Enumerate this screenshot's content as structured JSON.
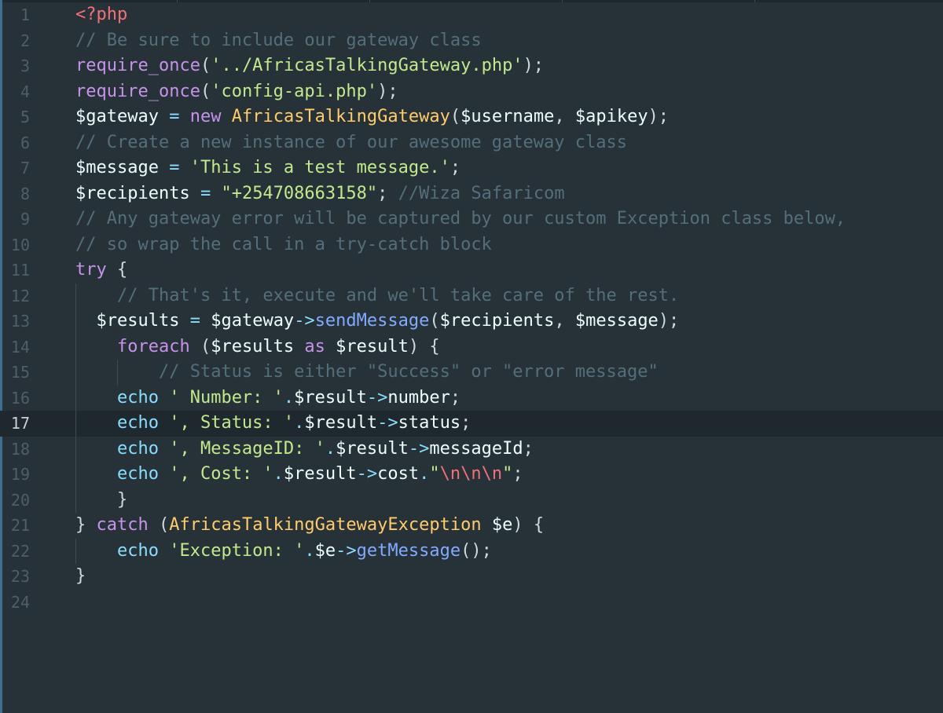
{
  "editor": {
    "language": "php",
    "active_line": 17,
    "colors": {
      "background": "#263238",
      "active_line_bg": "#1e282e",
      "line_number": "#4f5f68",
      "comment": "#546e7a",
      "string": "#c3e88d",
      "keyword": "#c792ea",
      "class_name": "#ffcb6b",
      "operator": "#89ddff",
      "method": "#82aaff",
      "php_tag": "#f07178"
    },
    "lines": [
      {
        "n": "1",
        "tokens": [
          {
            "t": "<?php",
            "c": "tag"
          }
        ]
      },
      {
        "n": "2",
        "tokens": [
          {
            "t": "// Be sure to include our gateway class",
            "c": "cmt"
          }
        ]
      },
      {
        "n": "3",
        "tokens": [
          {
            "t": "require_once",
            "c": "fn"
          },
          {
            "t": "(",
            "c": "punc"
          },
          {
            "t": "'../AfricasTalkingGateway.php'",
            "c": "str"
          },
          {
            "t": ");",
            "c": "punc"
          }
        ]
      },
      {
        "n": "4",
        "tokens": [
          {
            "t": "require_once",
            "c": "fn"
          },
          {
            "t": "(",
            "c": "punc"
          },
          {
            "t": "'config-api.php'",
            "c": "str"
          },
          {
            "t": ");",
            "c": "punc"
          }
        ]
      },
      {
        "n": "5",
        "tokens": [
          {
            "t": "$gateway",
            "c": "var"
          },
          {
            "t": " = ",
            "c": "op"
          },
          {
            "t": "new",
            "c": "kw"
          },
          {
            "t": " ",
            "c": "punc"
          },
          {
            "t": "AfricasTalkingGateway",
            "c": "cls"
          },
          {
            "t": "(",
            "c": "punc"
          },
          {
            "t": "$username",
            "c": "var"
          },
          {
            "t": ", ",
            "c": "punc"
          },
          {
            "t": "$apikey",
            "c": "var"
          },
          {
            "t": ");",
            "c": "punc"
          }
        ]
      },
      {
        "n": "6",
        "tokens": [
          {
            "t": "// Create a new instance of our awesome gateway class",
            "c": "cmt"
          }
        ]
      },
      {
        "n": "7",
        "tokens": [
          {
            "t": "$message",
            "c": "var"
          },
          {
            "t": " = ",
            "c": "op"
          },
          {
            "t": "'This is a test message.'",
            "c": "str"
          },
          {
            "t": ";",
            "c": "punc"
          }
        ]
      },
      {
        "n": "8",
        "tokens": [
          {
            "t": "$recipients",
            "c": "var"
          },
          {
            "t": " = ",
            "c": "op"
          },
          {
            "t": "\"+254708663158\"",
            "c": "str"
          },
          {
            "t": "; ",
            "c": "punc"
          },
          {
            "t": "//Wiza Safaricom",
            "c": "cmt"
          }
        ]
      },
      {
        "n": "9",
        "tokens": [
          {
            "t": "// Any gateway error will be captured by our custom Exception class below,",
            "c": "cmt"
          }
        ]
      },
      {
        "n": "10",
        "tokens": [
          {
            "t": "// so wrap the call in a try-catch block",
            "c": "cmt"
          }
        ]
      },
      {
        "n": "11",
        "tokens": [
          {
            "t": "try",
            "c": "kw"
          },
          {
            "t": " {",
            "c": "punc"
          }
        ]
      },
      {
        "n": "12",
        "tokens": [
          {
            "t": "    ",
            "c": "punc"
          },
          {
            "t": "// That's it, execute and we'll take care of the rest.",
            "c": "cmt"
          }
        ]
      },
      {
        "n": "13",
        "tokens": [
          {
            "t": "  ",
            "c": "punc"
          },
          {
            "t": "$results",
            "c": "var"
          },
          {
            "t": " = ",
            "c": "op"
          },
          {
            "t": "$gateway",
            "c": "var"
          },
          {
            "t": "->",
            "c": "op"
          },
          {
            "t": "sendMessage",
            "c": "call"
          },
          {
            "t": "(",
            "c": "punc"
          },
          {
            "t": "$recipients",
            "c": "var"
          },
          {
            "t": ", ",
            "c": "punc"
          },
          {
            "t": "$message",
            "c": "var"
          },
          {
            "t": ");",
            "c": "punc"
          }
        ]
      },
      {
        "n": "14",
        "tokens": [
          {
            "t": "    ",
            "c": "punc"
          },
          {
            "t": "foreach",
            "c": "kw"
          },
          {
            "t": " (",
            "c": "punc"
          },
          {
            "t": "$results",
            "c": "var"
          },
          {
            "t": " ",
            "c": "punc"
          },
          {
            "t": "as",
            "c": "kw"
          },
          {
            "t": " ",
            "c": "punc"
          },
          {
            "t": "$result",
            "c": "var"
          },
          {
            "t": ") {",
            "c": "punc"
          }
        ]
      },
      {
        "n": "15",
        "tokens": [
          {
            "t": "        ",
            "c": "punc"
          },
          {
            "t": "// Status is either \"Success\" or \"error message\"",
            "c": "cmt"
          }
        ]
      },
      {
        "n": "16",
        "tokens": [
          {
            "t": "    ",
            "c": "punc"
          },
          {
            "t": "echo",
            "c": "echo"
          },
          {
            "t": " ",
            "c": "punc"
          },
          {
            "t": "' Number: '",
            "c": "str"
          },
          {
            "t": ".",
            "c": "op"
          },
          {
            "t": "$result",
            "c": "var"
          },
          {
            "t": "->",
            "c": "op"
          },
          {
            "t": "number",
            "c": "var"
          },
          {
            "t": ";",
            "c": "punc"
          }
        ]
      },
      {
        "n": "17",
        "tokens": [
          {
            "t": "    ",
            "c": "punc"
          },
          {
            "t": "echo",
            "c": "echo"
          },
          {
            "t": " ",
            "c": "punc"
          },
          {
            "t": "', Status: '",
            "c": "str"
          },
          {
            "t": ".",
            "c": "op"
          },
          {
            "t": "$result",
            "c": "var"
          },
          {
            "t": "->",
            "c": "op"
          },
          {
            "t": "status",
            "c": "var"
          },
          {
            "t": ";",
            "c": "punc"
          }
        ]
      },
      {
        "n": "18",
        "tokens": [
          {
            "t": "    ",
            "c": "punc"
          },
          {
            "t": "echo",
            "c": "echo"
          },
          {
            "t": " ",
            "c": "punc"
          },
          {
            "t": "', MessageID: '",
            "c": "str"
          },
          {
            "t": ".",
            "c": "op"
          },
          {
            "t": "$result",
            "c": "var"
          },
          {
            "t": "->",
            "c": "op"
          },
          {
            "t": "messageId",
            "c": "var"
          },
          {
            "t": ";",
            "c": "punc"
          }
        ]
      },
      {
        "n": "19",
        "tokens": [
          {
            "t": "    ",
            "c": "punc"
          },
          {
            "t": "echo",
            "c": "echo"
          },
          {
            "t": " ",
            "c": "punc"
          },
          {
            "t": "', Cost: '",
            "c": "str"
          },
          {
            "t": ".",
            "c": "op"
          },
          {
            "t": "$result",
            "c": "var"
          },
          {
            "t": "->",
            "c": "op"
          },
          {
            "t": "cost",
            "c": "var"
          },
          {
            "t": ".",
            "c": "op"
          },
          {
            "t": "\"",
            "c": "str"
          },
          {
            "t": "\\n\\n\\n",
            "c": "esc"
          },
          {
            "t": "\"",
            "c": "str"
          },
          {
            "t": ";",
            "c": "punc"
          }
        ]
      },
      {
        "n": "20",
        "tokens": [
          {
            "t": "    }",
            "c": "punc"
          }
        ]
      },
      {
        "n": "21",
        "tokens": [
          {
            "t": "} ",
            "c": "punc"
          },
          {
            "t": "catch",
            "c": "kw"
          },
          {
            "t": " (",
            "c": "punc"
          },
          {
            "t": "AfricasTalkingGatewayException",
            "c": "cls"
          },
          {
            "t": " ",
            "c": "punc"
          },
          {
            "t": "$e",
            "c": "var"
          },
          {
            "t": ") {",
            "c": "punc"
          }
        ]
      },
      {
        "n": "22",
        "tokens": [
          {
            "t": "    ",
            "c": "punc"
          },
          {
            "t": "echo",
            "c": "echo"
          },
          {
            "t": " ",
            "c": "punc"
          },
          {
            "t": "'Exception: '",
            "c": "str"
          },
          {
            "t": ".",
            "c": "op"
          },
          {
            "t": "$e",
            "c": "var"
          },
          {
            "t": "->",
            "c": "op"
          },
          {
            "t": "getMessage",
            "c": "call"
          },
          {
            "t": "();",
            "c": "punc"
          }
        ]
      },
      {
        "n": "23",
        "tokens": [
          {
            "t": "}",
            "c": "punc"
          }
        ]
      },
      {
        "n": "24",
        "tokens": []
      }
    ]
  }
}
